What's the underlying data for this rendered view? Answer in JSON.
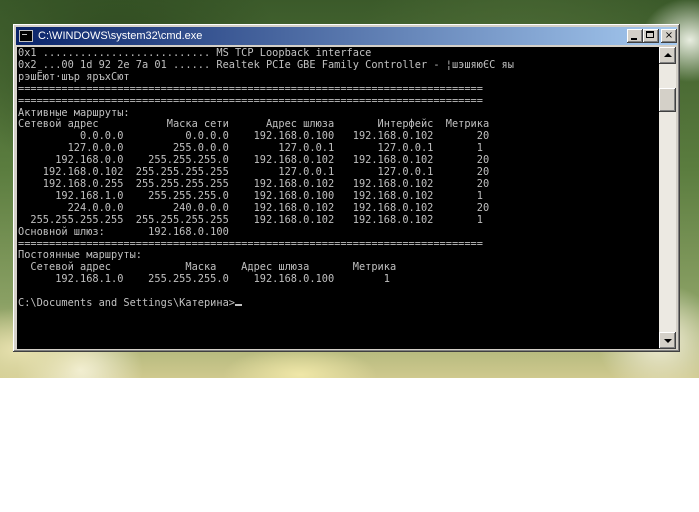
{
  "window": {
    "title": "C:\\WINDOWS\\system32\\cmd.exe",
    "buttons": {
      "minimize": "",
      "maximize": "",
      "close": "×"
    }
  },
  "console": {
    "lines": [
      "0x1 ........................... MS TCP Loopback interface",
      "0x2 ...00 1d 92 2e 7a 01 ...... Realtek PCIe GBE Family Controller - ¦шэшяюЄС яы",
      "рэшЁют·шър яръхСют",
      "===========================================================================",
      "===========================================================================",
      "Активные маршруты:",
      "Сетевой адрес           Маска сети      Адрес шлюза       Интерфейс  Метрика",
      "          0.0.0.0          0.0.0.0    192.168.0.100   192.168.0.102       20",
      "        127.0.0.0        255.0.0.0        127.0.0.1       127.0.0.1       1",
      "      192.168.0.0    255.255.255.0    192.168.0.102   192.168.0.102       20",
      "    192.168.0.102  255.255.255.255        127.0.0.1       127.0.0.1       20",
      "    192.168.0.255  255.255.255.255    192.168.0.102   192.168.0.102       20",
      "      192.168.1.0    255.255.255.0    192.168.0.100   192.168.0.102       1",
      "        224.0.0.0        240.0.0.0    192.168.0.102   192.168.0.102       20",
      "  255.255.255.255  255.255.255.255    192.168.0.102   192.168.0.102       1",
      "Основной шлюз:       192.168.0.100",
      "===========================================================================",
      "Постоянные маршруты:",
      "  Сетевой адрес            Маска    Адрес шлюза       Метрика",
      "      192.168.1.0    255.255.255.0    192.168.0.100        1",
      "",
      "C:\\Documents and Settings\\Катерина>"
    ]
  },
  "icons": {
    "window_icon": "cmd-icon",
    "minimize": "minimize-icon",
    "maximize": "maximize-icon",
    "close": "close-icon",
    "scroll_up": "arrow-up-icon",
    "scroll_down": "arrow-down-icon"
  }
}
